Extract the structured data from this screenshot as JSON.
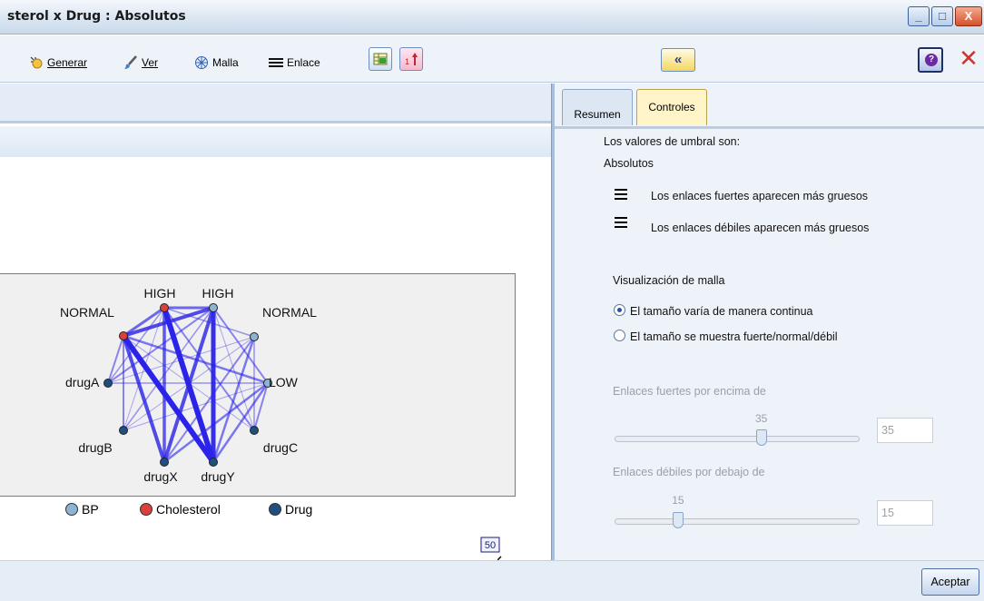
{
  "window": {
    "title": "sterol x Drug : Absolutos",
    "controls": {
      "minimize": "_",
      "maximize": "□",
      "close": "X"
    }
  },
  "toolbar": {
    "generate_label": "Generar",
    "view_label": "Ver",
    "web_label": "Malla",
    "link_label": "Enlace",
    "collapse_glyph": "«",
    "help_glyph": "?",
    "close_glyph": "✕"
  },
  "graph": {
    "nodes": [
      {
        "label": "NORMAL",
        "category": "Cholesterol"
      },
      {
        "label": "HIGH",
        "category": "Cholesterol"
      },
      {
        "label": "HIGH",
        "category": "BP"
      },
      {
        "label": "NORMAL",
        "category": "BP"
      },
      {
        "label": "LOW",
        "category": "BP"
      },
      {
        "label": "drugA",
        "category": "Drug"
      },
      {
        "label": "drugB",
        "category": "Drug"
      },
      {
        "label": "drugC",
        "category": "Drug"
      },
      {
        "label": "drugX",
        "category": "Drug"
      },
      {
        "label": "drugY",
        "category": "Drug"
      }
    ],
    "legend": [
      {
        "label": "BP",
        "color": "#8fb3d3"
      },
      {
        "label": "Cholesterol",
        "color": "#d9423c"
      },
      {
        "label": "Drug",
        "color": "#1f4f7e"
      }
    ]
  },
  "link_slider": {
    "value": "50",
    "ticks": [
      "20",
      "40"
    ]
  },
  "tabs": [
    {
      "label": "Resumen",
      "active": false
    },
    {
      "label": "Controles",
      "active": true
    }
  ],
  "controls": {
    "threshold_heading": "Los valores de umbral son:",
    "threshold_value": "Absolutos",
    "strong_links_note": "Los enlaces fuertes aparecen más gruesos",
    "weak_links_note": "Los enlaces débiles aparecen más gruesos",
    "web_display_heading": "Visualización de malla",
    "radio_continuous": "El tamaño varía de manera continua",
    "radio_discrete": "El tamaño se muestra fuerte/normal/débil",
    "strong_above_label": "Enlaces fuertes por encima de",
    "strong_above_value": "35",
    "strong_above_level": 0.6,
    "weak_below_label": "Enlaces débiles por debajo de",
    "weak_below_value": "15",
    "weak_below_level": 0.26
  },
  "footer": {
    "accept_label": "Aceptar"
  }
}
